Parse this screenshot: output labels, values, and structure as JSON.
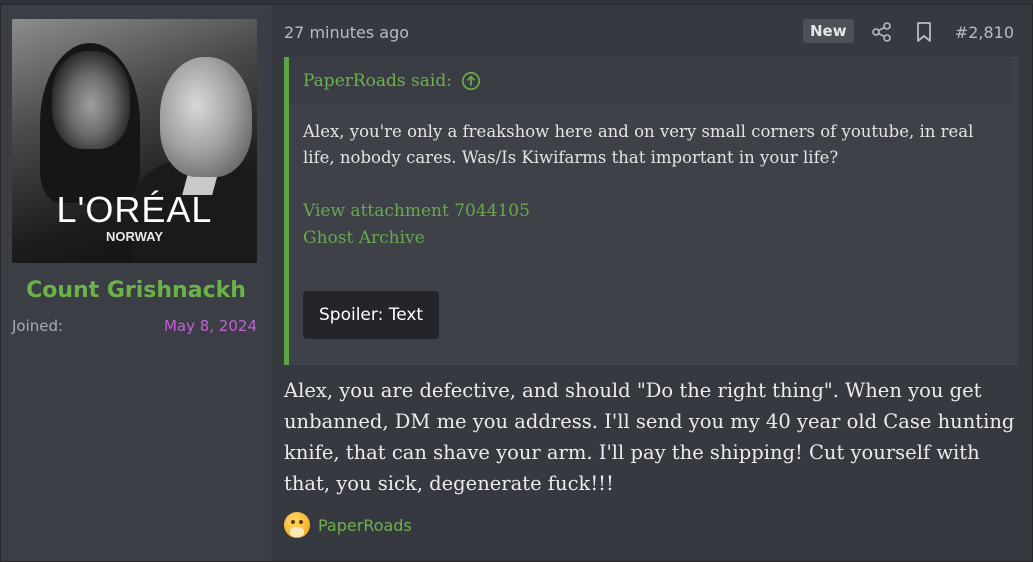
{
  "user": {
    "avatar_brand": "L'ORÉAL",
    "avatar_sub": "NORWAY",
    "username": "Count Grishnackh",
    "joined_label": "Joined:",
    "joined_value": "May 8, 2024"
  },
  "post": {
    "time": "27 minutes ago",
    "new_badge": "New",
    "number": "#2,810",
    "quote": {
      "author": "PaperRoads said:",
      "body": "Alex, you're only a freakshow here and on very small corners of youtube, in real life, nobody cares. Was/Is Kiwifarms that important in your life?",
      "attachment_link": "View attachment 7044105",
      "archive_link": "Ghost Archive",
      "spoiler_label": "Spoiler: Text"
    },
    "body": "Alex, you are defective, and should \"Do the right thing\". When you get unbanned, DM me you address. I'll send you my 40 year old Case hunting knife, that can shave your arm. I'll pay the shipping! Cut yourself with that, you sick, degenerate fuck!!!",
    "reaction": {
      "icon": "thinking-face-icon",
      "user": "PaperRoads"
    }
  },
  "colors": {
    "accent_green": "#6cb24a",
    "joined_purple": "#c55ed8",
    "quote_bar": "#5da544"
  }
}
